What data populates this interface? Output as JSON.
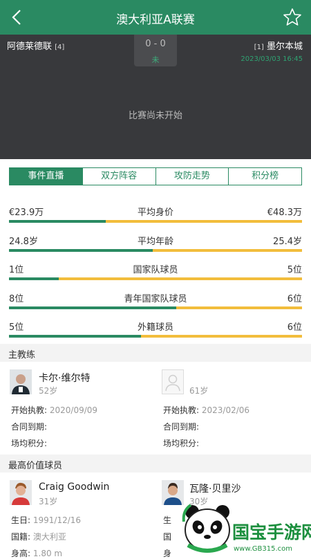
{
  "header": {
    "title": "澳大利亚A联赛"
  },
  "match": {
    "home_team": "阿德莱德联",
    "home_rank": "[4]",
    "away_team": "墨尔本城",
    "away_rank": "[1]",
    "score": "0 - 0",
    "status": "未",
    "datetime": "2023/03/03 16:45",
    "message": "比赛尚未开始"
  },
  "tabs": [
    "事件直播",
    "双方阵容",
    "攻防走势",
    "积分榜"
  ],
  "stats": [
    {
      "name": "平均身价",
      "home": "€23.9万",
      "away": "€48.3万",
      "home_share": 0.33
    },
    {
      "name": "平均年龄",
      "home": "24.8岁",
      "away": "25.4岁",
      "home_share": 0.49
    },
    {
      "name": "国家队球员",
      "home": "1位",
      "away": "5位",
      "home_share": 0.17
    },
    {
      "name": "青年国家队球员",
      "home": "8位",
      "away": "6位",
      "home_share": 0.57
    },
    {
      "name": "外籍球员",
      "home": "5位",
      "away": "6位",
      "home_share": 0.45
    }
  ],
  "coach_section": {
    "title": "主教练"
  },
  "coaches": [
    {
      "name": "卡尔·维尔特",
      "age": "52岁",
      "start_label": "开始执教:",
      "start": "2020/09/09",
      "contract_label": "合同到期:",
      "contract": "",
      "points_label": "场均积分:",
      "points": ""
    },
    {
      "name": "",
      "age": "61岁",
      "start_label": "开始执教:",
      "start": "2023/02/06",
      "contract_label": "合同到期:",
      "contract": "",
      "points_label": "场均积分:",
      "points": ""
    }
  ],
  "player_section": {
    "title": "最高价值球员"
  },
  "players": [
    {
      "name": "Craig Goodwin",
      "age": "31岁",
      "birth_label": "生日:",
      "birth": "1991/12/16",
      "nation_label": "国籍:",
      "nation": "澳大利亚",
      "height_label": "身高:",
      "height": "1.80 m"
    },
    {
      "name": "瓦隆·贝里沙",
      "age": "30岁",
      "birth_label": "生",
      "nation_label": "国",
      "height_label": "身"
    }
  ],
  "watermark": {
    "brand": "国宝手游网",
    "url": "www.GB315.com"
  },
  "colors": {
    "primary": "#2a8a62",
    "accent": "#f2bd3c",
    "dark_bg": "#38393c"
  }
}
